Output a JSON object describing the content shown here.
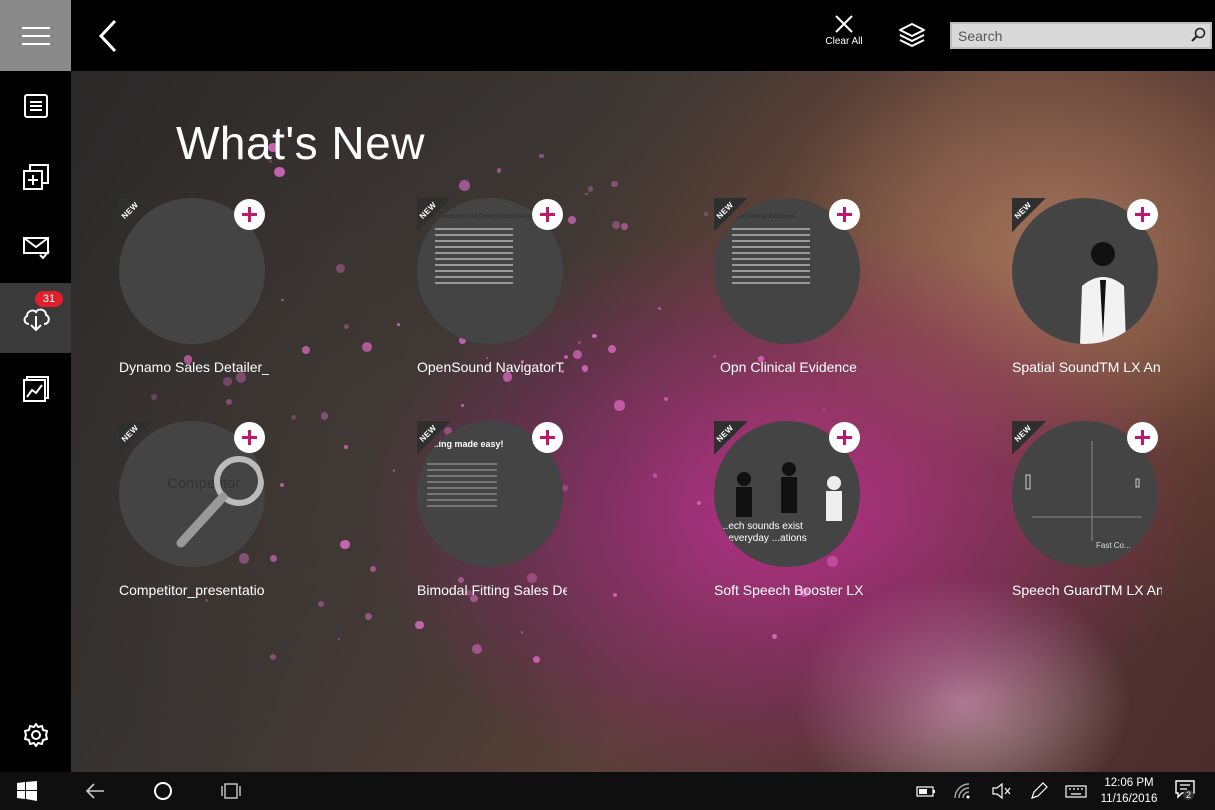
{
  "topbar": {
    "clear_all_label": "Clear All",
    "search_placeholder": "Search"
  },
  "rail": {
    "downloads_badge": "31"
  },
  "main": {
    "title": "What's New",
    "tiles": [
      {
        "caption": "Dynamo Sales Detailer_",
        "badge": "NEW",
        "thumb_text": ""
      },
      {
        "caption": "OpenSound NavigatorT",
        "badge": "NEW",
        "thumb_text": "Introduction to OpenSound Navigator™"
      },
      {
        "caption": "Opn Clinical Evidence",
        "badge": "NEW",
        "thumb_text": "Opn Clinical Evidence"
      },
      {
        "caption": "Spatial SoundTM LX An",
        "badge": "NEW",
        "thumb_text": ""
      },
      {
        "caption": "Competitor_presentatio",
        "badge": "NEW",
        "thumb_text": "Competitor"
      },
      {
        "caption": "Bimodal Fitting Sales De",
        "badge": "NEW",
        "thumb_text": "...ing made easy!"
      },
      {
        "caption": "Soft Speech Booster LX",
        "badge": "NEW",
        "thumb_text": "...ech sounds exist ...everyday ...ations"
      },
      {
        "caption": "Speech GuardTM LX An",
        "badge": "NEW",
        "thumb_text": "Fast Co..."
      }
    ]
  },
  "taskbar": {
    "time": "12:06 PM",
    "date": "11/16/2016",
    "notifications": "2"
  },
  "colors": {
    "accent_plus": "#c0166e",
    "badge_red": "#e0202a",
    "rail_menu_bg": "#8a8a8a"
  },
  "icons": {
    "menu": "hamburger-icon",
    "back": "chevron-left-icon",
    "clear": "close-icon",
    "layers": "layers-icon",
    "search": "search-icon",
    "documents": "document-list-icon",
    "add": "add-to-collection-icon",
    "mail": "mail-check-icon",
    "downloads": "cloud-download-icon",
    "gallery": "image-chart-icon",
    "settings": "gear-icon"
  }
}
